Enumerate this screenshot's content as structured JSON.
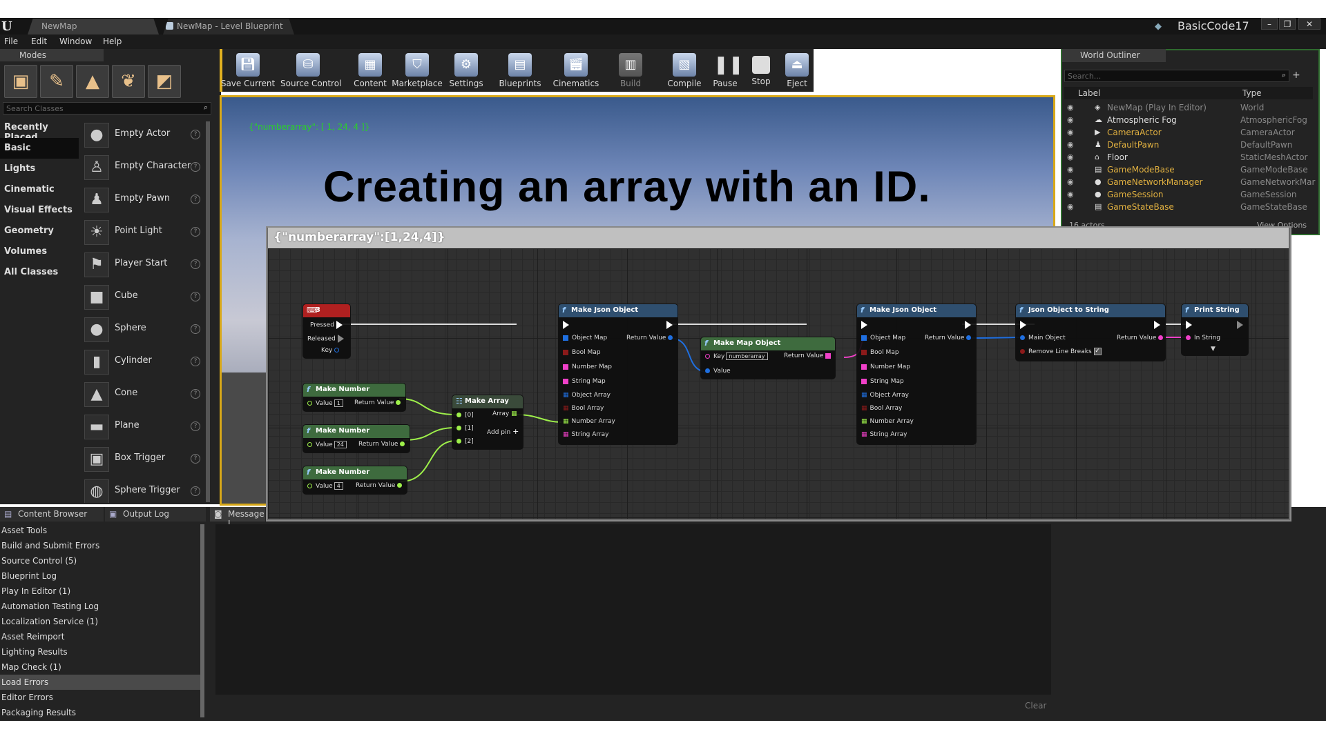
{
  "window": {
    "tabs": [
      "NewMap",
      "NewMap - Level Blueprint"
    ],
    "user": "BasicCode17",
    "controls": [
      "–",
      "❐",
      "✕"
    ]
  },
  "menu": [
    "File",
    "Edit",
    "Window",
    "Help"
  ],
  "modes": {
    "tab_label": "Modes",
    "search_placeholder": "Search Classes",
    "categories": [
      "Recently Placed",
      "Basic",
      "Lights",
      "Cinematic",
      "Visual Effects",
      "Geometry",
      "Volumes",
      "All Classes"
    ],
    "items": [
      "Empty Actor",
      "Empty Character",
      "Empty Pawn",
      "Point Light",
      "Player Start",
      "Cube",
      "Sphere",
      "Cylinder",
      "Cone",
      "Plane",
      "Box Trigger",
      "Sphere Trigger"
    ]
  },
  "toolbar": [
    "Save Current",
    "Source Control",
    "Content",
    "Marketplace",
    "Settings",
    "Blueprints",
    "Cinematics",
    "Build",
    "Compile",
    "Pause",
    "Stop",
    "Eject"
  ],
  "viewport": {
    "debug_text": "{\"numberarray\": [ 1, 24, 4 ]}",
    "heading": "Creating an array with an ID."
  },
  "outliner": {
    "tab_label": "World Outliner",
    "search_placeholder": "Search...",
    "col_label": "Label",
    "col_type": "Type",
    "rows": [
      {
        "label": "NewMap (Play In Editor)",
        "type": "World"
      },
      {
        "label": "Atmospheric Fog",
        "type": "AtmosphericFog"
      },
      {
        "label": "CameraActor",
        "type": "CameraActor"
      },
      {
        "label": "DefaultPawn",
        "type": "DefaultPawn"
      },
      {
        "label": "Floor",
        "type": "StaticMeshActor"
      },
      {
        "label": "GameModeBase",
        "type": "GameModeBase"
      },
      {
        "label": "GameNetworkManager",
        "type": "GameNetworkMar"
      },
      {
        "label": "GameSession",
        "type": "GameSession"
      },
      {
        "label": "GameStateBase",
        "type": "GameStateBase"
      }
    ],
    "footer_count": "16 actors",
    "view_options": "View Options"
  },
  "bottom": {
    "tabs": [
      "Content Browser",
      "Output Log",
      "Message L"
    ],
    "log_items": [
      "Asset Tools",
      "Build and Submit Errors",
      "Source Control (5)",
      "Blueprint Log",
      "Play In Editor (1)",
      "Automation Testing Log",
      "Localization Service (1)",
      "Asset Reimport",
      "Lighting Results",
      "Map Check (1)",
      "Load Errors",
      "Editor Errors",
      "Packaging Results"
    ],
    "clear": "Clear"
  },
  "blueprint": {
    "title": "{\"numberarray\":[1,24,4]}",
    "key_event": {
      "title": "3",
      "pins": [
        "Pressed",
        "Released",
        "Key"
      ]
    },
    "make_numbers": [
      {
        "title": "Make Number",
        "value_label": "Value",
        "value": "1",
        "out": "Return Value"
      },
      {
        "title": "Make Number",
        "value_label": "Value",
        "value": "24",
        "out": "Return Value"
      },
      {
        "title": "Make Number",
        "value_label": "Value",
        "value": "4",
        "out": "Return Value"
      }
    ],
    "make_array": {
      "title": "Make Array",
      "pins": [
        "[0]",
        "[1]",
        "[2]"
      ],
      "out": "Array",
      "add": "Add pin"
    },
    "make_json_1": {
      "title": "Make Json Object",
      "pins": [
        "Object Map",
        "Bool Map",
        "Number Map",
        "String Map",
        "Object Array",
        "Bool Array",
        "Number Array",
        "String Array"
      ],
      "out": "Return Value"
    },
    "make_map": {
      "title": "Make Map Object",
      "key_label": "Key",
      "key_value": "numberarray",
      "value_label": "Value",
      "out": "Return Value"
    },
    "make_json_2": {
      "title": "Make Json Object",
      "pins": [
        "Object Map",
        "Bool Map",
        "Number Map",
        "String Map",
        "Object Array",
        "Bool Array",
        "Number Array",
        "String Array"
      ],
      "out": "Return Value"
    },
    "json_to_string": {
      "title": "Json Object to String",
      "pins": [
        "Main Object",
        "Remove Line Breaks"
      ],
      "out": "Return Value"
    },
    "print_string": {
      "title": "Print String",
      "pins": [
        "In String"
      ]
    }
  },
  "colors": {
    "accent": "#d8a818",
    "debug_green": "#2ad02a",
    "float_pin": "#9ef04a",
    "object_pin": "#1f6fe0",
    "string_pin": "#f040c8",
    "exec_pin": "#ffffff"
  }
}
